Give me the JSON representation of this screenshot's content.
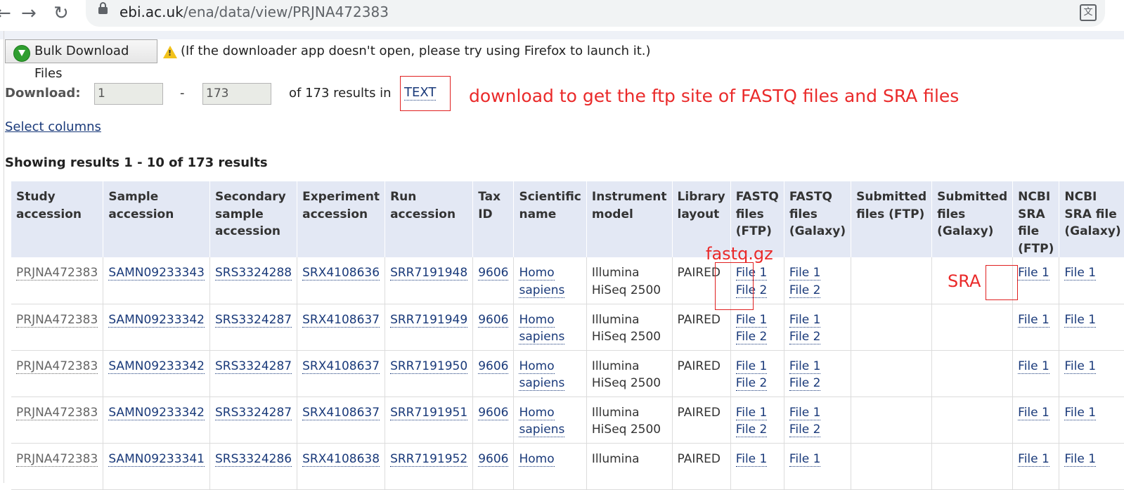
{
  "browser": {
    "url_domain": "ebi.ac.uk",
    "url_path": "/ena/data/view/PRJNA472383"
  },
  "bulk": {
    "button_label": "Bulk Download Files",
    "warning": "(If the downloader app doesn't open, please try using Firefox to launch it.)"
  },
  "download": {
    "label": "Download:",
    "from": "1",
    "to": "173",
    "dash": "-",
    "of_text": "of 173 results in",
    "format": "TEXT"
  },
  "annotations": {
    "main": "download to get the ftp site of FASTQ files and SRA files",
    "fastq": "fastq.gz",
    "sra": "SRA"
  },
  "select_columns": "Select columns",
  "showing": "Showing results 1 - 10 of 173 results",
  "table": {
    "headers": [
      "Study accession",
      "Sample accession",
      "Secondary sample accession",
      "Experiment accession",
      "Run accession",
      "Tax ID",
      "Scientific name",
      "Instrument model",
      "Library layout",
      "FASTQ files (FTP)",
      "FASTQ files (Galaxy)",
      "Submitted files (FTP)",
      "Submitted files (Galaxy)",
      "NCBI SRA file (FTP)",
      "NCBI SRA file (Galaxy)"
    ],
    "rows": [
      {
        "study": "PRJNA472383",
        "sample": "SAMN09233343",
        "secondary": "SRS3324288",
        "experiment": "SRX4108636",
        "run": "SRR7191948",
        "tax": "9606",
        "sci1": "Homo",
        "sci2": "sapiens",
        "inst1": "Illumina",
        "inst2": "HiSeq 2500",
        "layout": "PAIRED",
        "fq1": "File 1",
        "fq2": "File 2",
        "gx1": "File 1",
        "gx2": "File 2",
        "sra": "File 1",
        "sragx": "File 1"
      },
      {
        "study": "PRJNA472383",
        "sample": "SAMN09233342",
        "secondary": "SRS3324287",
        "experiment": "SRX4108637",
        "run": "SRR7191949",
        "tax": "9606",
        "sci1": "Homo",
        "sci2": "sapiens",
        "inst1": "Illumina",
        "inst2": "HiSeq 2500",
        "layout": "PAIRED",
        "fq1": "File 1",
        "fq2": "File 2",
        "gx1": "File 1",
        "gx2": "File 2",
        "sra": "File 1",
        "sragx": "File 1"
      },
      {
        "study": "PRJNA472383",
        "sample": "SAMN09233342",
        "secondary": "SRS3324287",
        "experiment": "SRX4108637",
        "run": "SRR7191950",
        "tax": "9606",
        "sci1": "Homo",
        "sci2": "sapiens",
        "inst1": "Illumina",
        "inst2": "HiSeq 2500",
        "layout": "PAIRED",
        "fq1": "File 1",
        "fq2": "File 2",
        "gx1": "File 1",
        "gx2": "File 2",
        "sra": "File 1",
        "sragx": "File 1"
      },
      {
        "study": "PRJNA472383",
        "sample": "SAMN09233342",
        "secondary": "SRS3324287",
        "experiment": "SRX4108637",
        "run": "SRR7191951",
        "tax": "9606",
        "sci1": "Homo",
        "sci2": "sapiens",
        "inst1": "Illumina",
        "inst2": "HiSeq 2500",
        "layout": "PAIRED",
        "fq1": "File 1",
        "fq2": "File 2",
        "gx1": "File 1",
        "gx2": "File 2",
        "sra": "File 1",
        "sragx": "File 1"
      },
      {
        "study": "PRJNA472383",
        "sample": "SAMN09233341",
        "secondary": "SRS3324286",
        "experiment": "SRX4108638",
        "run": "SRR7191952",
        "tax": "9606",
        "sci1": "Homo",
        "sci2": "",
        "inst1": "Illumina",
        "inst2": "",
        "layout": "PAIRED",
        "fq1": "File 1",
        "fq2": "",
        "gx1": "File 1",
        "gx2": "",
        "sra": "File 1",
        "sragx": "File 1"
      }
    ]
  }
}
